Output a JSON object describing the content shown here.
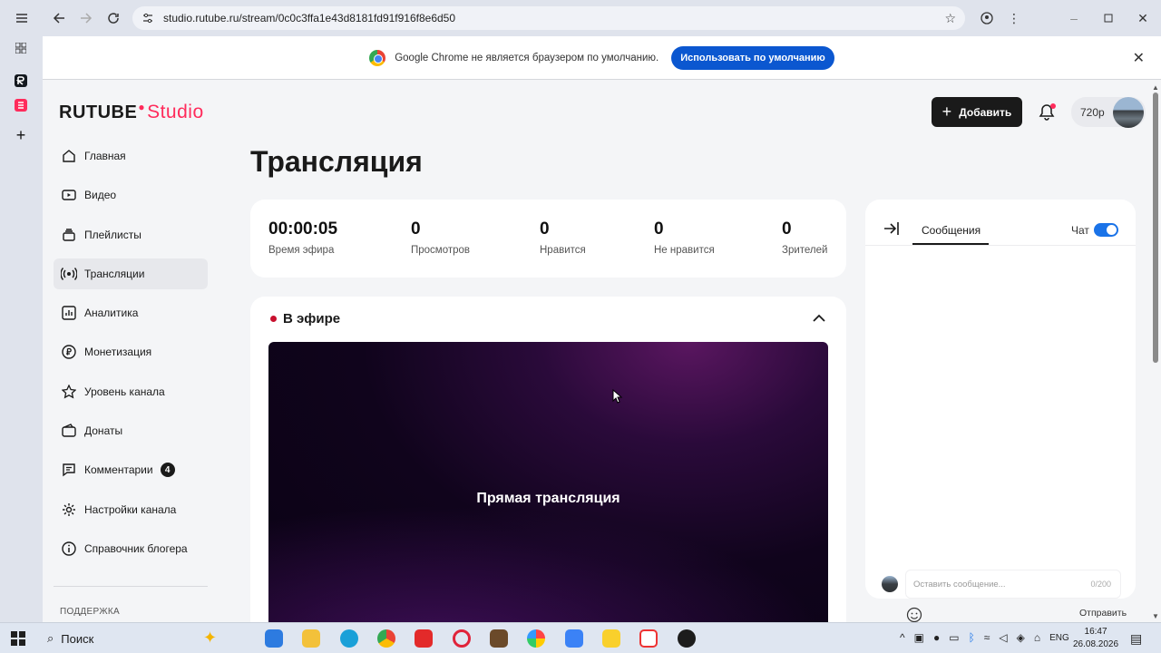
{
  "browser": {
    "url": "studio.rutube.ru/stream/0c0c3ffa1e43d8181fd91f916f8e6d50"
  },
  "infobar": {
    "message": "Google Chrome не является браузером по умолчанию.",
    "button": "Использовать по умолчанию"
  },
  "brand": {
    "name": "RUTUBE",
    "product": "Studio",
    "color": "#ff2b5b"
  },
  "header": {
    "add_label": "Добавить",
    "quality": "720p"
  },
  "sidebar": {
    "items": [
      {
        "label": "Главная",
        "icon": "home-icon"
      },
      {
        "label": "Видео",
        "icon": "video-icon"
      },
      {
        "label": "Плейлисты",
        "icon": "playlist-icon"
      },
      {
        "label": "Трансляции",
        "icon": "broadcast-icon",
        "active": true
      },
      {
        "label": "Аналитика",
        "icon": "analytics-icon"
      },
      {
        "label": "Монетизация",
        "icon": "ruble-icon"
      },
      {
        "label": "Уровень канала",
        "icon": "star-icon"
      },
      {
        "label": "Донаты",
        "icon": "donate-icon"
      },
      {
        "label": "Комментарии",
        "icon": "comment-icon",
        "badge": "4"
      },
      {
        "label": "Настройки канала",
        "icon": "gear-icon"
      },
      {
        "label": "Справочник блогера",
        "icon": "info-icon"
      }
    ],
    "support_label": "ПОДДЕРЖКА"
  },
  "main": {
    "title": "Трансляция",
    "stats": [
      {
        "value": "00:00:05",
        "label": "Время эфира"
      },
      {
        "value": "0",
        "label": "Просмотров"
      },
      {
        "value": "0",
        "label": "Нравится"
      },
      {
        "value": "0",
        "label": "Не нравится"
      },
      {
        "value": "0",
        "label": "Зрителей"
      }
    ],
    "live": {
      "heading": "В эфире",
      "player_label": "Прямая трансляция",
      "live_color": "#c8102e"
    }
  },
  "chat": {
    "tab": "Сообщения",
    "chat_label": "Чат",
    "toggle_on": true,
    "input_placeholder": "Оставить сообщение...",
    "counter": "0/200",
    "send_label": "Отправить"
  },
  "taskbar": {
    "search_label": "Поиск",
    "language": "ENG",
    "time": "16:47",
    "date": "26.08.2026"
  }
}
